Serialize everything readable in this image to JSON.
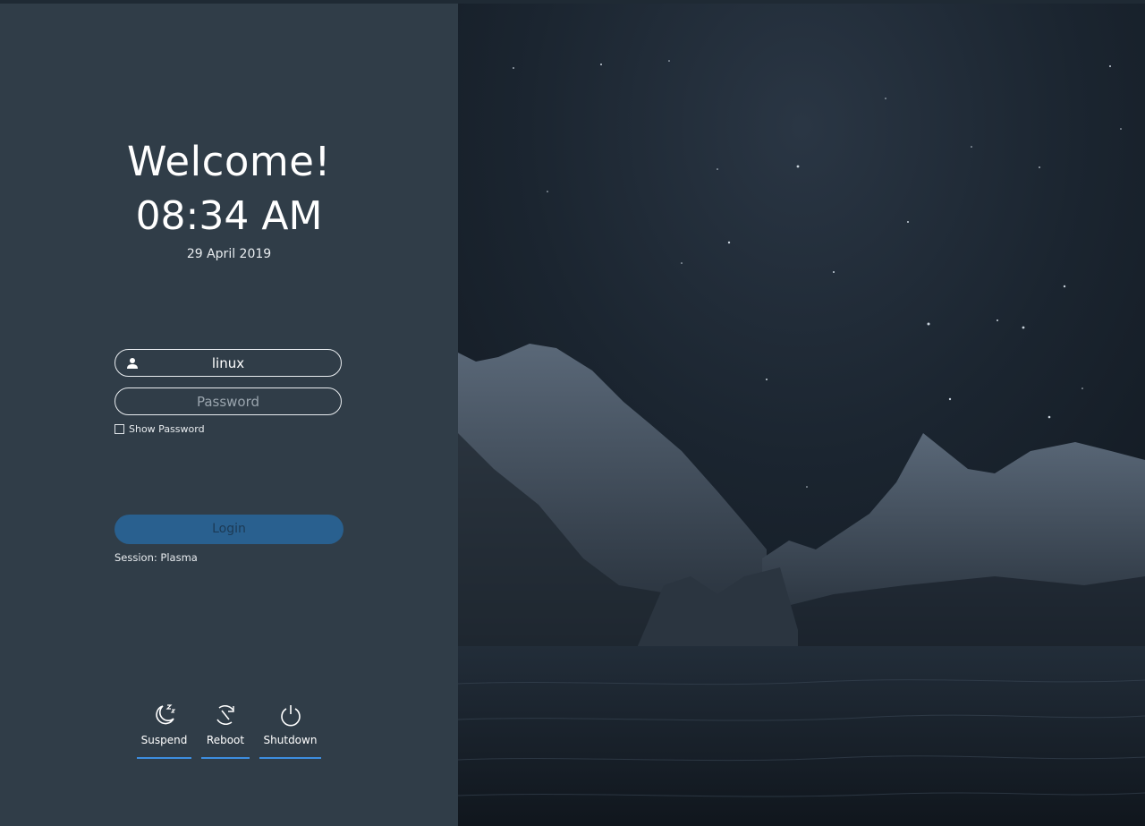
{
  "greeting": "Welcome!",
  "clock": {
    "time": "08:34 AM",
    "date": "29 April 2019"
  },
  "login_form": {
    "username_value": "linux",
    "password_placeholder": "Password",
    "show_password_label": "Show Password",
    "login_label": "Login",
    "session_label": "Session: Plasma"
  },
  "power_actions": [
    {
      "label": "Suspend",
      "icon": "suspend-moon-icon"
    },
    {
      "label": "Reboot",
      "icon": "reboot-icon"
    },
    {
      "label": "Shutdown",
      "icon": "power-icon"
    }
  ],
  "colors": {
    "panel": "#303d48",
    "accent": "#3d8ee0",
    "login_button": "#29608f"
  }
}
